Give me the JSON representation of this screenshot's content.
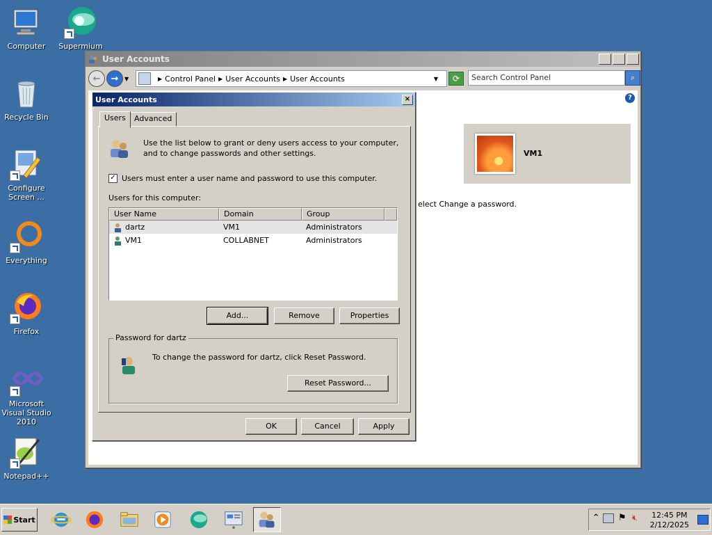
{
  "desktop": {
    "icons": [
      {
        "label": "Computer",
        "icon": "computer-icon"
      },
      {
        "label": "Supermium",
        "icon": "supermium-icon"
      },
      {
        "label": "Recycle Bin",
        "icon": "recycle-bin-icon"
      },
      {
        "label": "Configure Screen ...",
        "icon": "configure-screen-icon"
      },
      {
        "label": "Everything",
        "icon": "everything-icon"
      },
      {
        "label": "Firefox",
        "icon": "firefox-icon"
      },
      {
        "label": "Microsoft Visual Studio 2010",
        "icon": "visual-studio-icon"
      },
      {
        "label": "Notepad++",
        "icon": "notepadpp-icon"
      }
    ]
  },
  "control_panel": {
    "title": "User Accounts",
    "breadcrumb": [
      "Control Panel",
      "User Accounts",
      "User Accounts"
    ],
    "search_placeholder": "Search Control Panel",
    "user_name": "VM1",
    "background_text": "elect Change a password."
  },
  "dialog": {
    "title": "User Accounts",
    "tabs": [
      "Users",
      "Advanced"
    ],
    "active_tab": "Users",
    "info_text": "Use the list below to grant or deny users access to your computer, and to change passwords and other settings.",
    "require_login_label": "Users must enter a user name and password to use this computer.",
    "require_login_checked": true,
    "list_label": "Users for this computer:",
    "columns": [
      "User Name",
      "Domain",
      "Group"
    ],
    "rows": [
      {
        "user": "dartz",
        "domain": "VM1",
        "group": "Administrators",
        "selected": true
      },
      {
        "user": "VM1",
        "domain": "COLLABNET",
        "group": "Administrators",
        "selected": false
      }
    ],
    "buttons": {
      "add": "Add...",
      "remove": "Remove",
      "properties": "Properties"
    },
    "password_group": {
      "legend": "Password for dartz",
      "text": "To change the password for dartz, click Reset Password.",
      "reset_button": "Reset Password..."
    },
    "footer": {
      "ok": "OK",
      "cancel": "Cancel",
      "apply": "Apply"
    }
  },
  "taskbar": {
    "start_label": "Start",
    "pinned": [
      "internet-explorer-icon",
      "firefox-icon",
      "explorer-icon",
      "media-player-icon",
      "supermium-icon",
      "control-panel-icon",
      "user-accounts-icon"
    ],
    "clock_time": "12:45 PM",
    "clock_date": "2/12/2025"
  },
  "colors": {
    "desktop": "#3a6ea5",
    "dialog_title_start": "#0a246a",
    "dialog_title_end": "#a6caf0",
    "face": "#d4d0c8"
  }
}
